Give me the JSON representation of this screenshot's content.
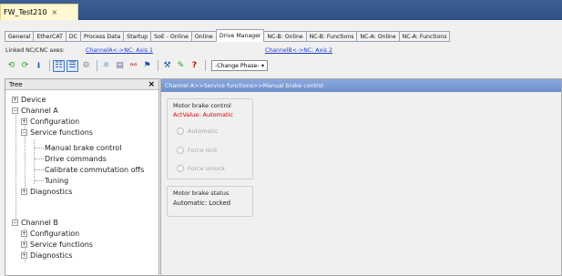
{
  "document": {
    "tab_title": "FW_Test210",
    "close_glyph": "×"
  },
  "tabs": [
    {
      "label": "General",
      "active": false
    },
    {
      "label": "EtherCAT",
      "active": false
    },
    {
      "label": "DC",
      "active": false
    },
    {
      "label": "Process Data",
      "active": false
    },
    {
      "label": "Startup",
      "active": false
    },
    {
      "label": "SoE - Online",
      "active": false
    },
    {
      "label": "Online",
      "active": false
    },
    {
      "label": "Drive Manager",
      "active": true
    },
    {
      "label": "NC-B: Online",
      "active": false
    },
    {
      "label": "NC-B: Functions",
      "active": false
    },
    {
      "label": "NC-A: Online",
      "active": false
    },
    {
      "label": "NC-A: Functions",
      "active": false
    }
  ],
  "linked": {
    "label": "Linked NC/CNC axes:",
    "link_a": "ChannelA<->NC: Axis 1",
    "link_b": "ChannelB<->NC: Axis 2"
  },
  "toolbar": {
    "icons": [
      "refresh-green-icon",
      "refresh-green-2-icon",
      "download-icon",
      "view-tree-icon",
      "view-list-icon",
      "settings-icon",
      "network-icon",
      "list-icon",
      "chart-icon",
      "plug-icon",
      "tools-icon",
      "wrench-icon",
      "help-icon"
    ],
    "phase_select": "-Change Phase-",
    "help_glyph": "?"
  },
  "tree": {
    "title": "Tree",
    "close_glyph": "×",
    "nodes": [
      {
        "label": "Device",
        "box": "+"
      },
      {
        "label": "Channel A",
        "box": "−"
      },
      {
        "label": "Configuration",
        "box": "+"
      },
      {
        "label": "Service functions",
        "box": "−"
      },
      {
        "label": "Manual brake control",
        "box": ""
      },
      {
        "label": "Drive commands",
        "box": ""
      },
      {
        "label": "Calibrate commutation offs",
        "box": ""
      },
      {
        "label": "Tuning",
        "box": ""
      },
      {
        "label": "Diagnostics",
        "box": "+"
      },
      {
        "label": "Channel B",
        "box": "−"
      },
      {
        "label": "Configuration",
        "box": "+"
      },
      {
        "label": "Service functions",
        "box": "+"
      },
      {
        "label": "Diagnostics",
        "box": "+"
      }
    ]
  },
  "main": {
    "header": "Channel A>>Service functions>>Manual brake control",
    "brake_control": {
      "title": "Motor brake control",
      "act_value": "ActValue: Automatic",
      "options": [
        "Automatic",
        "Force lock",
        "Force unlock"
      ]
    },
    "brake_status": {
      "title": "Motor brake status",
      "value": "Automatic: Locked"
    }
  },
  "colors": {
    "accent_blue": "#7f9fd7",
    "doc_tab": "#fff8d0",
    "act_red": "#d00000",
    "link_blue": "#1a3cc8"
  }
}
